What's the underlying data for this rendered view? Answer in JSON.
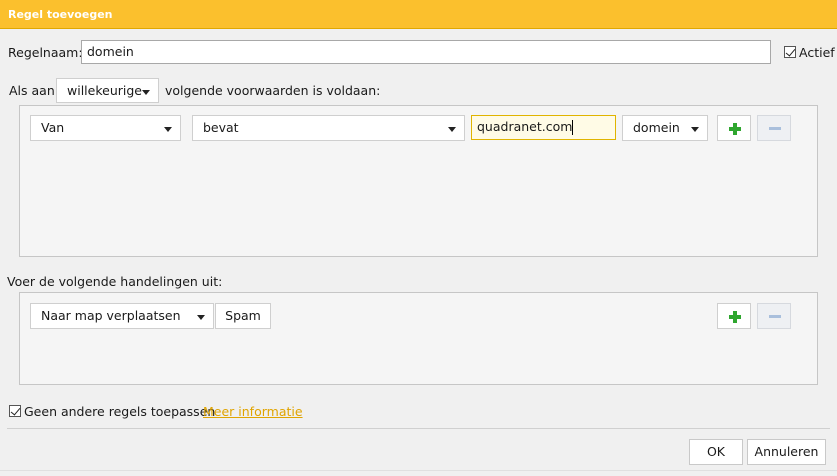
{
  "dialog": {
    "title": "Regel toevoegen"
  },
  "rule_name": {
    "label": "Regelnaam:",
    "value": "domein"
  },
  "active": {
    "label": "Actief",
    "checked": true
  },
  "conditions": {
    "prefix": "Als aan",
    "match_mode": "willekeurige",
    "suffix": "volgende voorwaarden is voldaan:",
    "rows": [
      {
        "field": "Van",
        "operator": "bevat",
        "value": "quadranet.com",
        "scope": "domein"
      }
    ]
  },
  "actions": {
    "heading": "Voer de volgende handelingen uit:",
    "rows": [
      {
        "action": "Naar map verplaatsen",
        "target": "Spam"
      }
    ]
  },
  "stop_rules": {
    "label": "Geen andere regels toepassen",
    "checked": true,
    "link": "Meer informatie"
  },
  "buttons": {
    "ok": "OK",
    "cancel": "Annuleren"
  },
  "colors": {
    "title_bar": "#fbc02d",
    "link": "#e0a400",
    "add_icon": "#2fa62f",
    "remove_icon_disabled": "#a9bfdc"
  },
  "icons": {
    "add": "plus-icon",
    "remove": "minus-icon",
    "dropdown": "chevron-down-icon",
    "checkbox": "check-icon"
  }
}
